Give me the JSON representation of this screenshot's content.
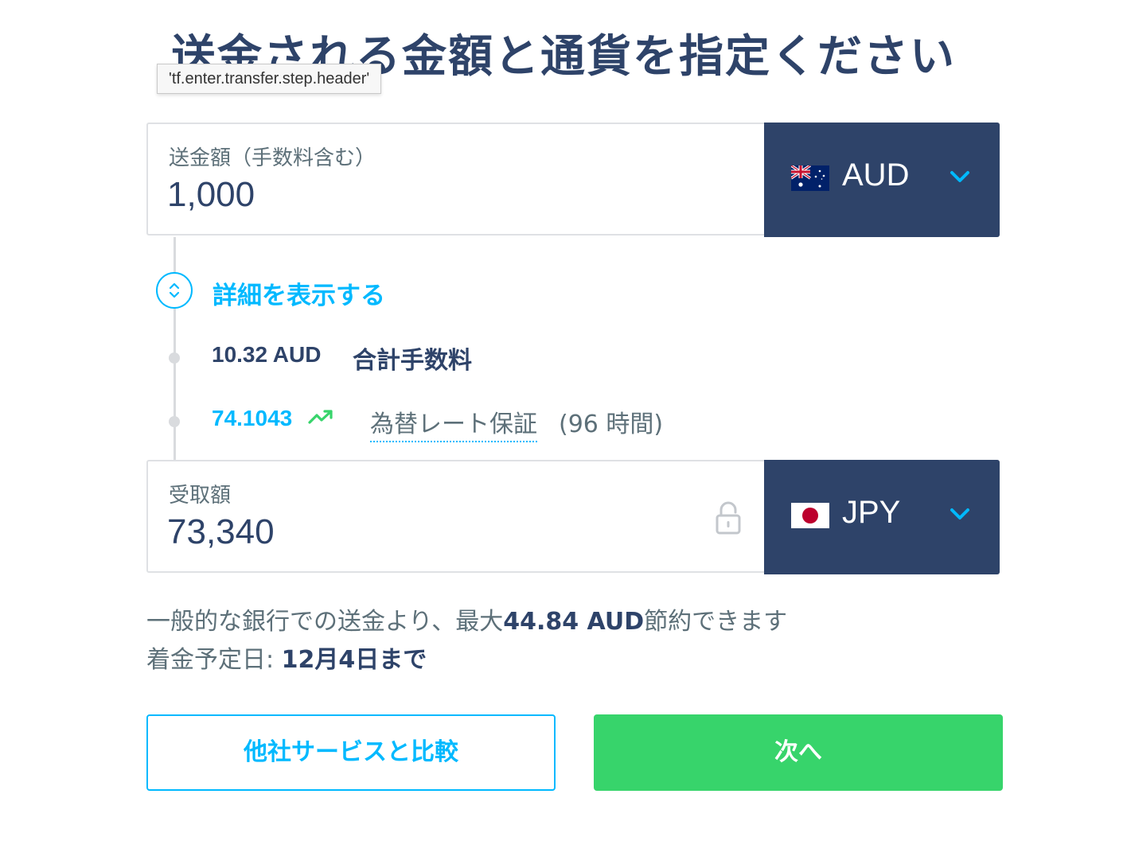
{
  "header": {
    "title": "送金される金額と通貨を指定ください",
    "tooltip": "'tf.enter.transfer.step.header'"
  },
  "send": {
    "label": "送金額（手数料含む）",
    "value": "1,000",
    "currency": "AUD",
    "flag": "australia-flag"
  },
  "details": {
    "toggle_label": "詳細を表示する",
    "fee_amount": "10.32 AUD",
    "fee_label": "合計手数料",
    "rate": "74.1043",
    "rate_guarantee": "為替レート保証",
    "rate_hours": "(96 時間)"
  },
  "receive": {
    "label": "受取額",
    "value": "73,340",
    "currency": "JPY",
    "flag": "japan-flag"
  },
  "info": {
    "savings_prefix": "一般的な銀行での送金より、最大",
    "savings_amount": "44.84 AUD",
    "savings_suffix": "節約できます",
    "arrival_prefix": "着金予定日: ",
    "arrival_date": "12月4日まで"
  },
  "buttons": {
    "compare": "他社サービスと比較",
    "next": "次へ"
  },
  "colors": {
    "navy": "#2e4369",
    "accent": "#00b9ff",
    "green": "#37d46b",
    "muted": "#5d7079"
  }
}
